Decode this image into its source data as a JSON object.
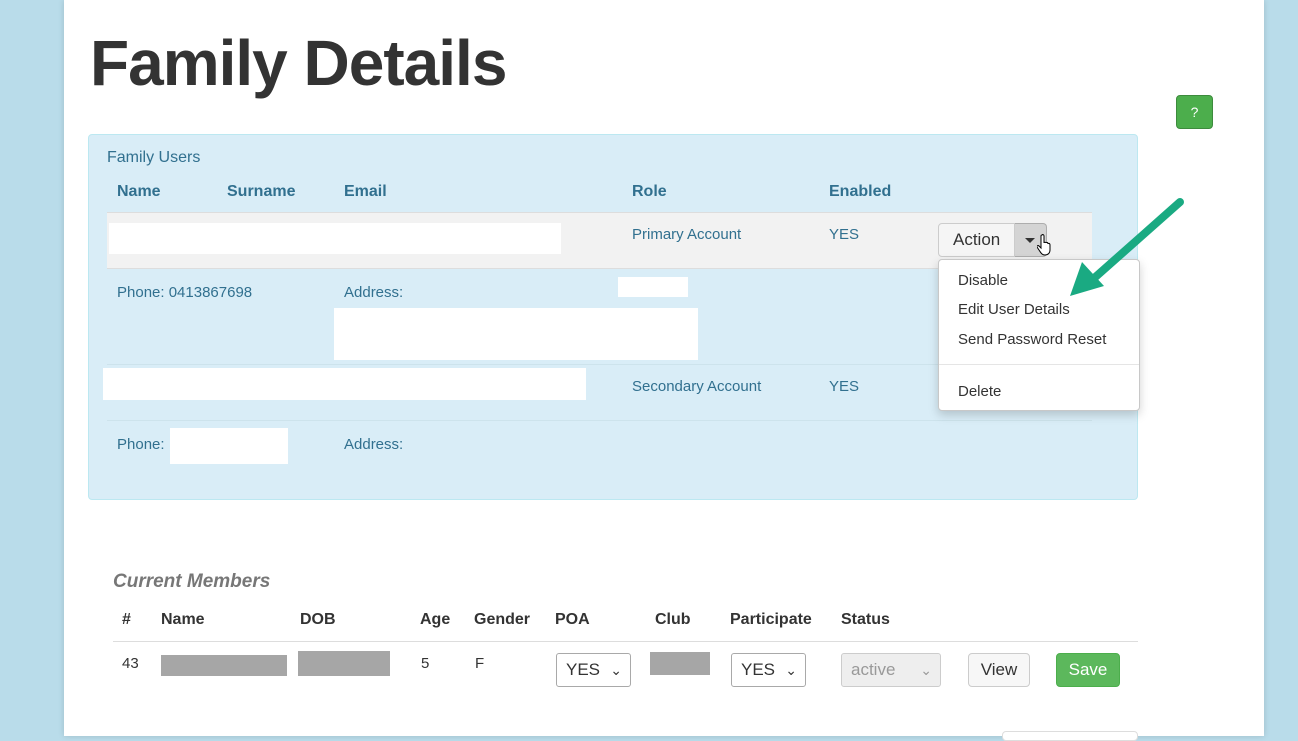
{
  "page": {
    "title": "Family Details",
    "help_label": "?"
  },
  "family_users": {
    "heading": "Family Users",
    "columns": {
      "name": "Name",
      "surname": "Surname",
      "email": "Email",
      "role": "Role",
      "enabled": "Enabled"
    },
    "users": [
      {
        "role": "Primary Account",
        "enabled": "YES",
        "phone_label": "Phone: 0413867698",
        "address_label": "Address:"
      },
      {
        "role": "Secondary Account",
        "enabled": "YES",
        "phone_label": "Phone: ",
        "address_label": "Address:"
      }
    ],
    "action_label": "Action",
    "action_menu": [
      "Disable",
      "Edit User Details",
      "Send Password Reset",
      "Delete"
    ]
  },
  "current_members": {
    "title": "Current Members",
    "columns": [
      "#",
      "Name",
      "DOB",
      "Age",
      "Gender",
      "POA",
      "Club",
      "Participate",
      "Status"
    ],
    "rows": [
      {
        "number": "43",
        "age": "5",
        "gender": "F",
        "poa": "YES",
        "participate": "YES",
        "status": "active"
      }
    ],
    "view_label": "View",
    "save_label": "Save"
  },
  "colors": {
    "accent_green": "#5cb85c",
    "panel_bg": "#d9edf7",
    "arrow": "#1aaa82"
  }
}
